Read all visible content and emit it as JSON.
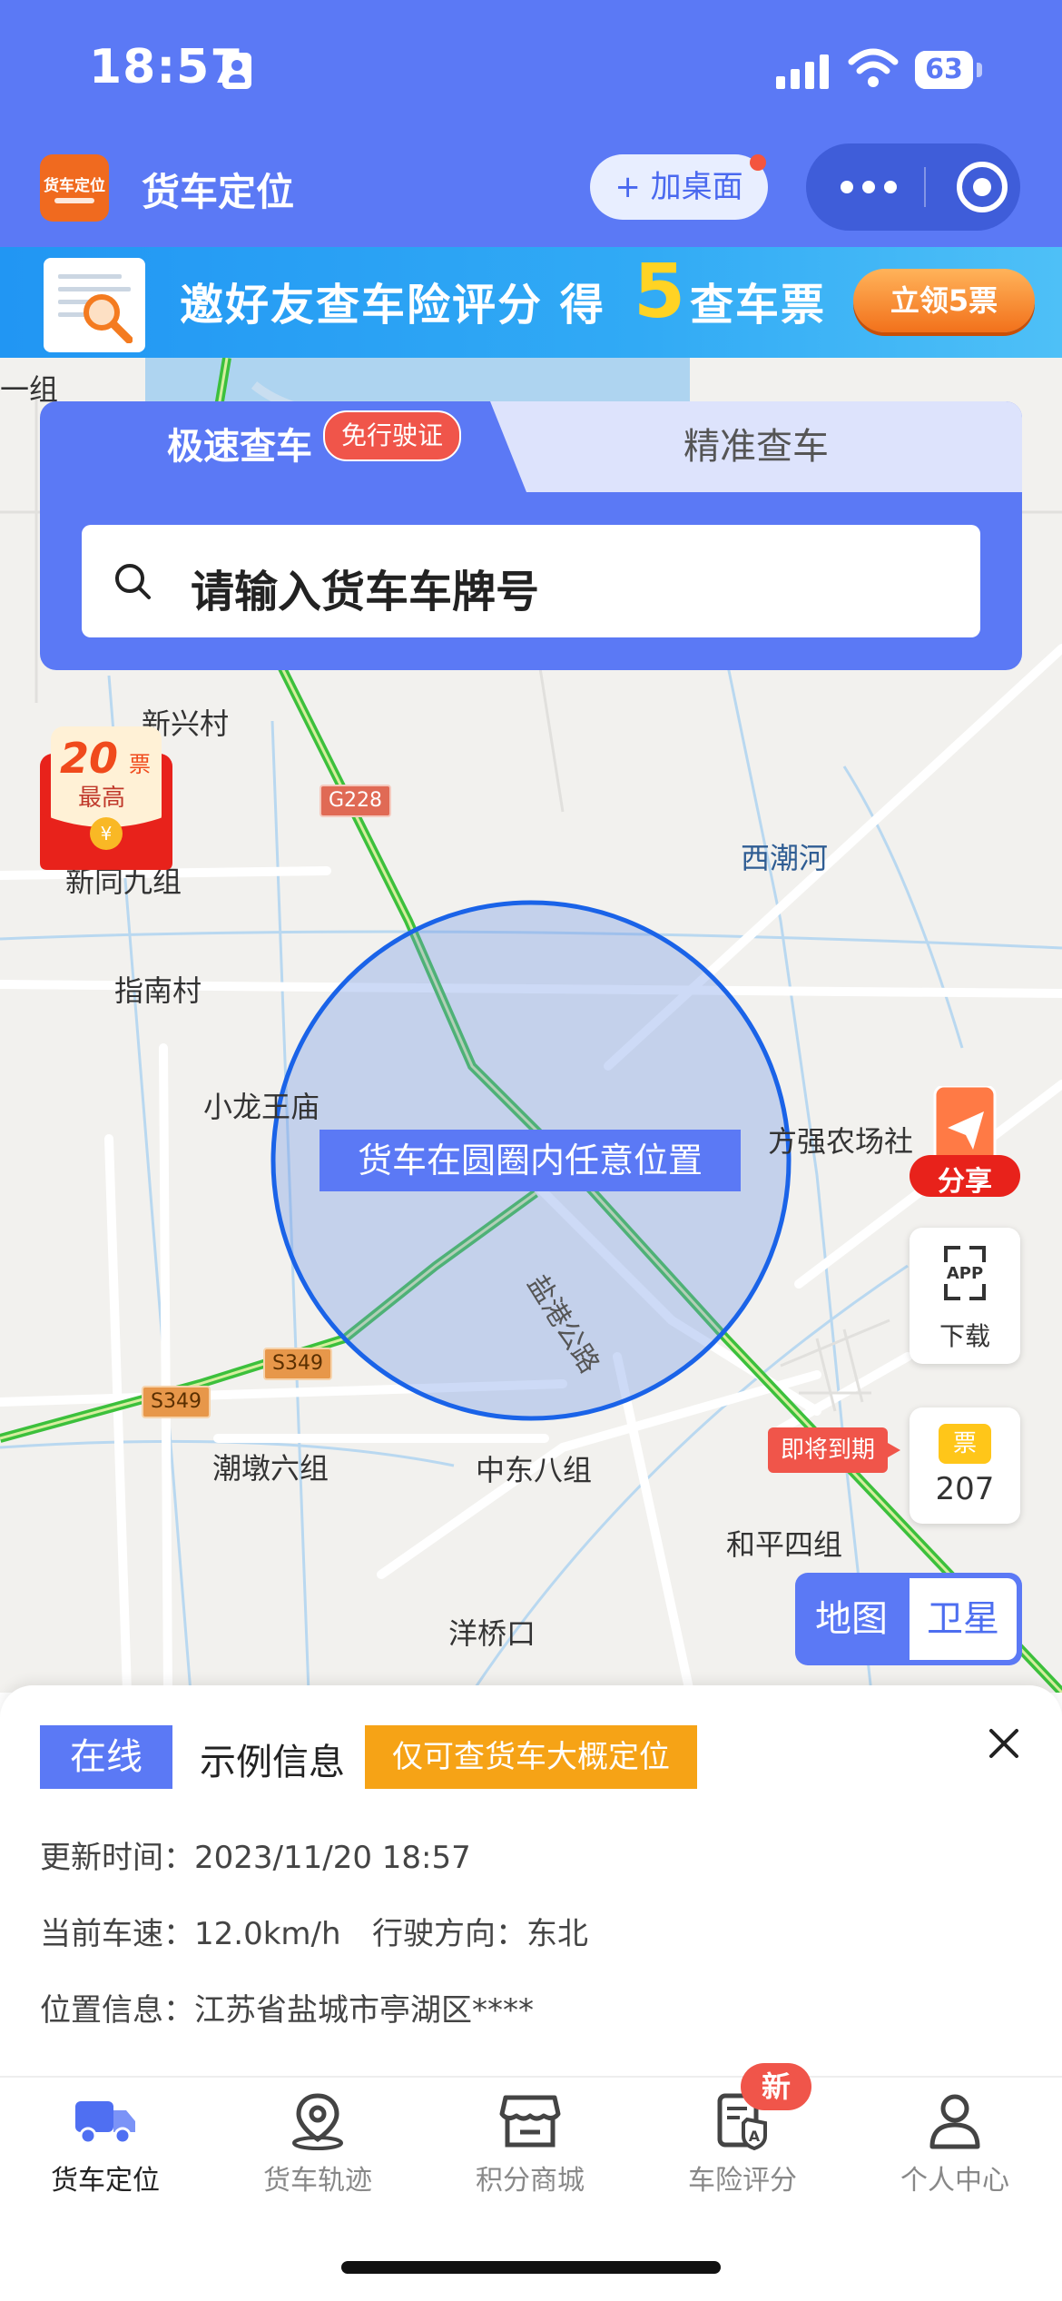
{
  "status_bar": {
    "time": "18:57",
    "battery": "63",
    "battery_level": 0.63
  },
  "app_bar": {
    "logo_text": "货车定位",
    "title": "货车定位",
    "add_to_desktop": "+ 加桌面"
  },
  "banner": {
    "text_a": "邀好友查车险评分 得",
    "number": "5",
    "text_b": "查车票",
    "button": "立领5票"
  },
  "search": {
    "tab_fast": "极速查车",
    "tab_fast_badge": "免行驶证",
    "tab_precise": "精准查车",
    "placeholder": "请输入货车车牌号"
  },
  "map": {
    "labels": [
      "新兴村",
      "新同九组",
      "西潮河",
      "指南村",
      "小龙王庙",
      "方强农场社",
      "潮墩六组",
      "中东八组",
      "和平四组",
      "洋桥口",
      "一组"
    ],
    "road_labels": [
      "G228",
      "S349",
      "S349",
      "盐港公路"
    ],
    "circle_label": "货车在圆圈内任意位置",
    "redpacket": {
      "amount": "20",
      "unit": "票",
      "caption": "最高"
    },
    "share": "分享",
    "app_download": "下载",
    "app_icon_text": "APP",
    "ticket_badge": "票",
    "ticket_count": "207",
    "expire_tag": "即将到期",
    "toggle_map": "地图",
    "toggle_satellite": "卫星"
  },
  "info": {
    "status": "在线",
    "example": "示例信息",
    "approx_tag": "仅可查货车大概定位",
    "update_time": "更新时间：2023/11/20 18:57",
    "speed": "当前车速：12.0km/h",
    "direction": "行驶方向：东北",
    "location": "位置信息：江苏省盐城市亭湖区****"
  },
  "bottom_nav": {
    "items": [
      {
        "label": "货车定位",
        "icon": "truck-icon",
        "active": true
      },
      {
        "label": "货车轨迹",
        "icon": "location-pin-icon",
        "active": false
      },
      {
        "label": "积分商城",
        "icon": "store-icon",
        "active": false
      },
      {
        "label": "车险评分",
        "icon": "insurance-icon",
        "active": false
      },
      {
        "label": "个人中心",
        "icon": "user-icon",
        "active": false
      }
    ],
    "new_badge": "新"
  },
  "colors": {
    "primary": "#5b79f5",
    "orange": "#f6a316",
    "red": "#f0554a"
  }
}
